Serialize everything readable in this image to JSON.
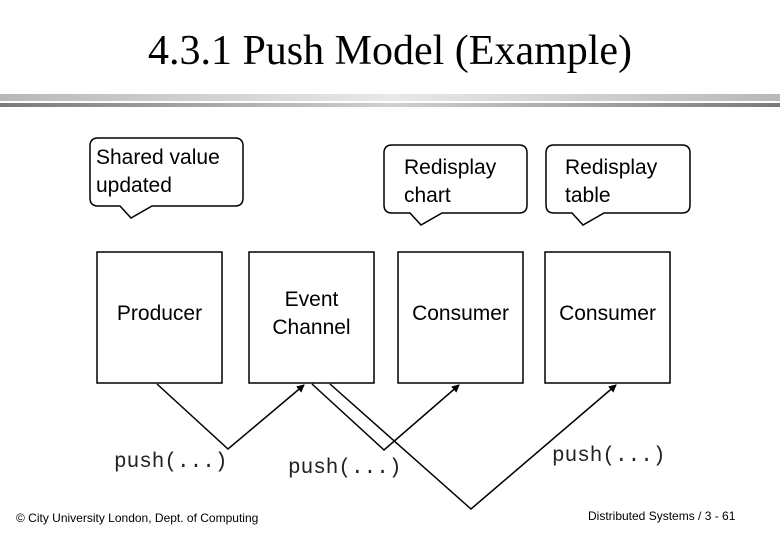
{
  "slide": {
    "title": "4.3.1 Push Model (Example)"
  },
  "callouts": [
    {
      "id": "shared",
      "lines": [
        "Shared value",
        "updated"
      ]
    },
    {
      "id": "chart",
      "lines": [
        "Redisplay",
        "chart"
      ]
    },
    {
      "id": "table",
      "lines": [
        "Redisplay",
        "table"
      ]
    }
  ],
  "boxes": [
    {
      "id": "producer",
      "lines": [
        "Producer"
      ]
    },
    {
      "id": "channel",
      "lines": [
        "Event",
        "Channel"
      ]
    },
    {
      "id": "consumer1",
      "lines": [
        "Consumer"
      ]
    },
    {
      "id": "consumer2",
      "lines": [
        "Consumer"
      ]
    }
  ],
  "push_labels": [
    "push(...)",
    "push(...)",
    "push(...)"
  ],
  "footer": {
    "left": "© City University London, Dept. of Computing",
    "right": "Distributed Systems / 3 - 61"
  }
}
